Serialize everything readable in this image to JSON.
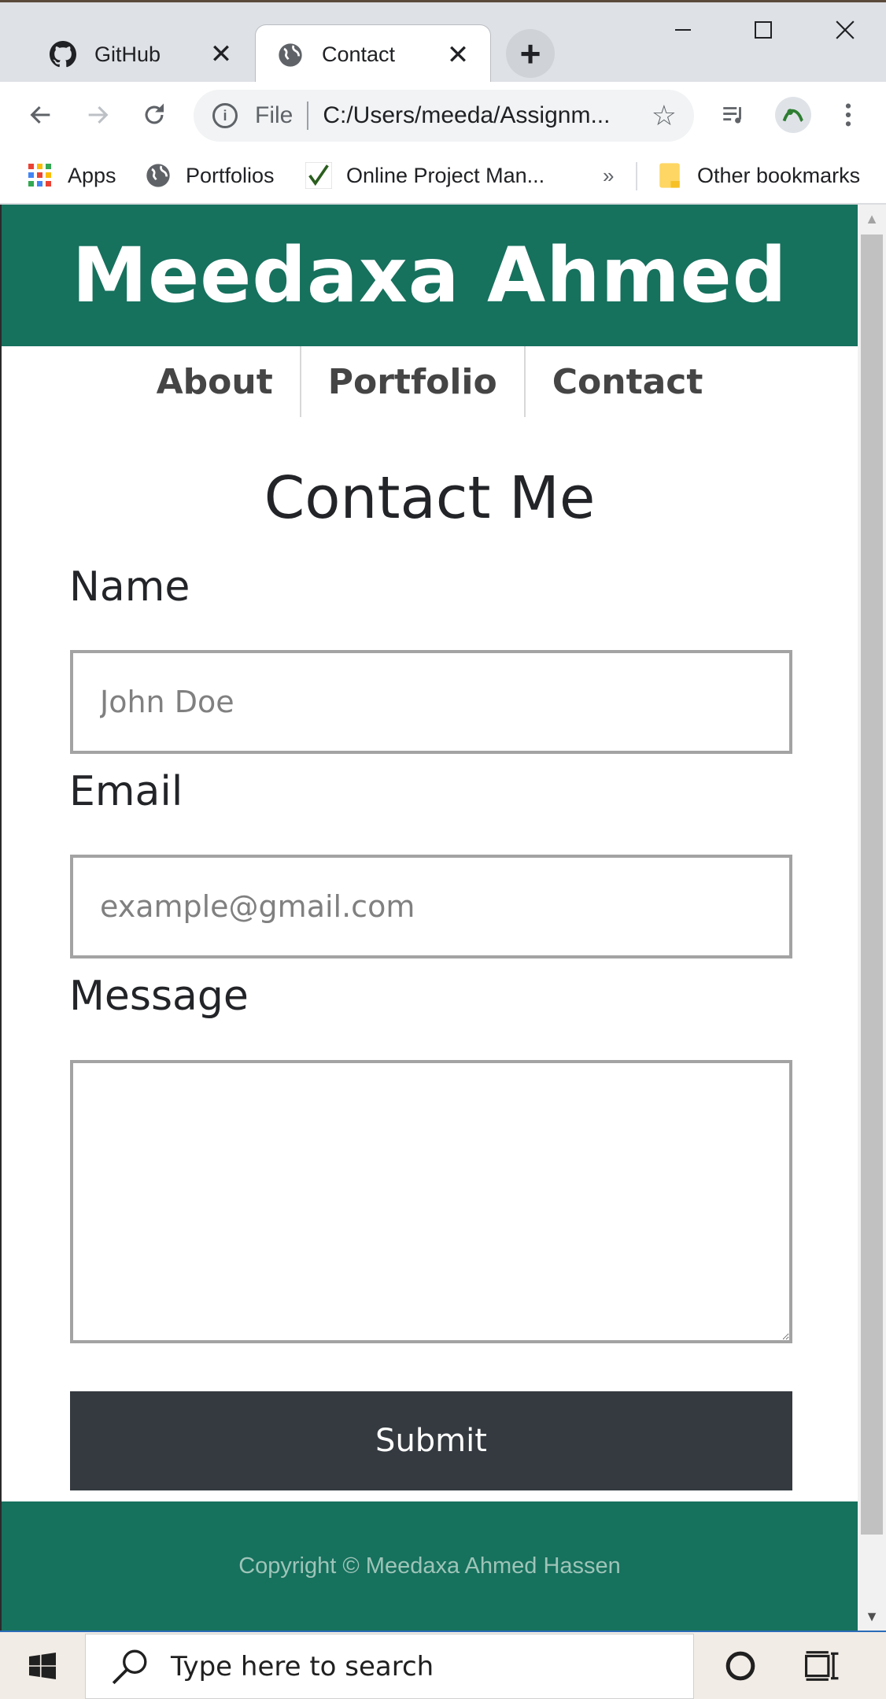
{
  "browser": {
    "tabs": [
      {
        "title": "GitHub",
        "icon": "github-icon",
        "active": false
      },
      {
        "title": "Contact",
        "icon": "globe-icon",
        "active": true
      }
    ],
    "new_tab_label": "+",
    "address": {
      "scheme": "File",
      "url": "C:/Users/meeda/Assignm..."
    },
    "bookmarks": [
      {
        "label": "Apps",
        "icon": "apps-grid-icon"
      },
      {
        "label": "Portfolios",
        "icon": "globe-icon"
      },
      {
        "label": "Online Project Man...",
        "icon": "checkmark-icon"
      }
    ],
    "bookmarks_overflow": "»",
    "other_bookmarks": "Other bookmarks"
  },
  "site": {
    "title": "Meedaxa Ahmed",
    "nav": [
      {
        "label": "About"
      },
      {
        "label": "Portfolio"
      },
      {
        "label": "Contact"
      }
    ],
    "heading": "Contact Me",
    "form": {
      "name_label": "Name",
      "name_placeholder": "John Doe",
      "email_label": "Email",
      "email_placeholder": "example@gmail.com",
      "message_label": "Message",
      "submit_label": "Submit"
    },
    "footer": "Copyright © Meedaxa Ahmed Hassen"
  },
  "taskbar": {
    "search_placeholder": "Type here to search"
  },
  "colors": {
    "header_bg": "#16715d",
    "submit_bg": "#343a40",
    "nav_text": "#454545"
  }
}
